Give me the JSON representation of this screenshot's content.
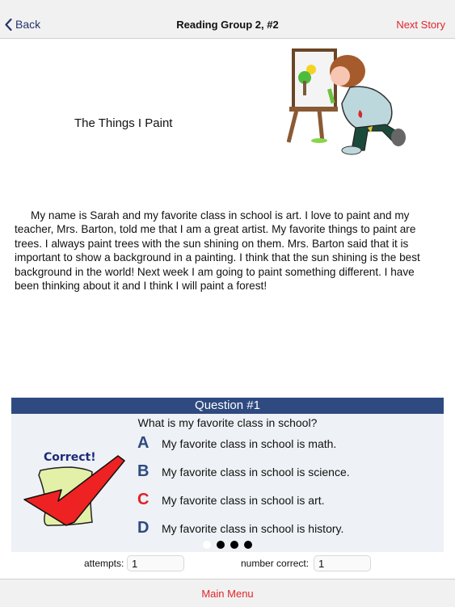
{
  "nav": {
    "back_label": "Back",
    "title": "Reading Group 2, #2",
    "next_label": "Next Story"
  },
  "story": {
    "title": "The Things I Paint",
    "illustration": "girl-painting-at-easel",
    "body": "My name is Sarah and my favorite class in school is art. I love to paint and my teacher, Mrs. Barton, told me that I am a great artist. My favorite things to paint are trees. I always paint trees with the sun shining on them. Mrs. Barton said that it is important to show a background in a painting. I think that the sun shining is the best background in the world! Next week I am going to paint something different. I have been thinking about it and I think I will paint a forest!"
  },
  "question": {
    "header": "Question #1",
    "text": "What is my favorite class in school?",
    "feedback": "Correct!",
    "answers": [
      {
        "letter": "A",
        "text": "My favorite class in school is math.",
        "correct": false
      },
      {
        "letter": "B",
        "text": "My favorite class in school is science.",
        "correct": false
      },
      {
        "letter": "C",
        "text": "My favorite class in school is art.",
        "correct": true
      },
      {
        "letter": "D",
        "text": "My favorite class in school is history.",
        "correct": false
      }
    ],
    "page_count": 4,
    "current_page": 1
  },
  "stats": {
    "attempts_label": "attempts:",
    "attempts_value": "1",
    "correct_label": "number correct:",
    "correct_value": "1"
  },
  "footer": {
    "main_menu_label": "Main Menu"
  },
  "colors": {
    "accent_red": "#e0262b",
    "header_blue": "#2e4a80",
    "back_blue": "#23346b"
  }
}
